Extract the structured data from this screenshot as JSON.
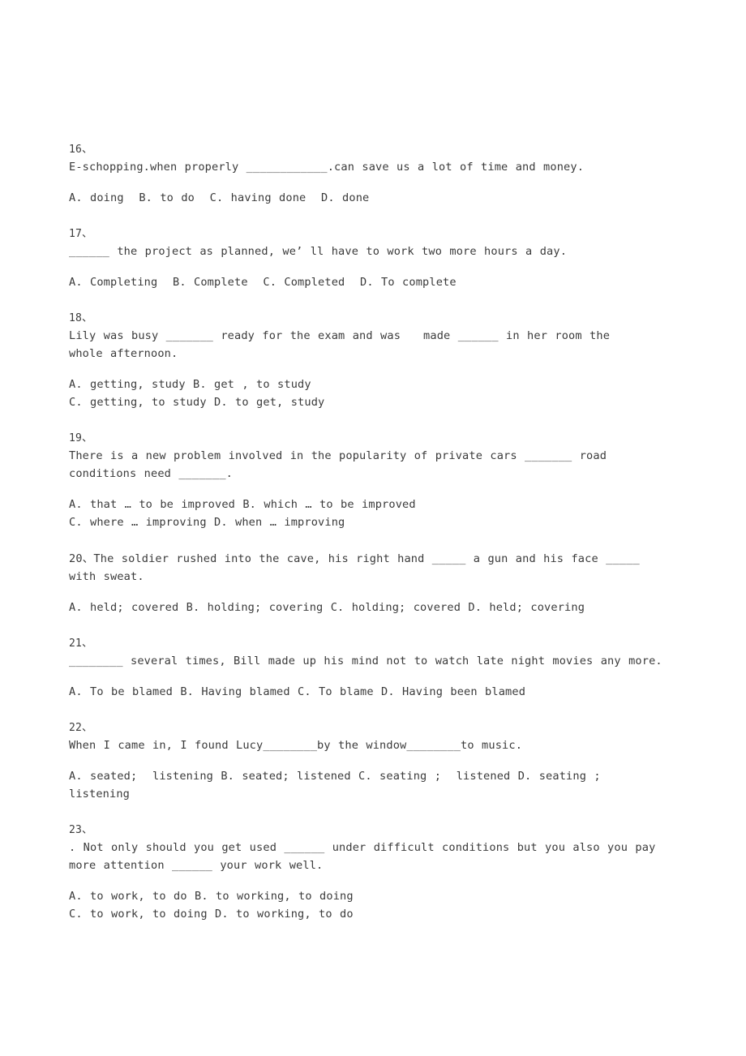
{
  "document": {
    "type": "worksheet",
    "subject": "English grammar multiple choice",
    "page_background": "#ffffff",
    "text_color": "#3a3a3a"
  },
  "questions": [
    {
      "number": "16、",
      "stem": "E-schopping.when properly ____________.can save us a lot of time and money.",
      "options": "A. doing  B. to do  C. having done  D. done"
    },
    {
      "number": "17、",
      "stem": "______ the project as planned, we’ ll have to work two more hours a day.",
      "options": "A. Completing  B. Complete  C. Completed  D. To complete"
    },
    {
      "number": "18、",
      "stem": "Lily was busy _______ ready for the exam and was   made ______ in her room the\nwhole afternoon.",
      "options": "A. getting, study B. get , to study\nC. getting, to study D. to get, study"
    },
    {
      "number": "19、",
      "stem": "There is a new problem involved in the popularity of private cars _______ road\nconditions need _______.",
      "options": "A. that … to be improved B. which … to be improved\nC. where … improving D. when … improving"
    },
    {
      "number": "",
      "stem": "20、The soldier rushed into the cave, his right hand _____ a gun and his face _____\nwith sweat.",
      "options": "A. held; covered B. holding; covering C. holding; covered D. held; covering"
    },
    {
      "number": "21、",
      "stem": "________ several times, Bill made up his mind not to watch late night movies any more.",
      "options": "A. To be blamed B. Having blamed C. To blame D. Having been blamed"
    },
    {
      "number": "22、",
      "stem": "When I came in, I found Lucy________by the window________to music.",
      "options": "A. seated;  listening B. seated; listened C. seating ;  listened D. seating ;\nlistening"
    },
    {
      "number": "23、",
      "stem": ". Not only should you get used ______ under difficult conditions but you also you pay\nmore attention ______ your work well.",
      "options": "A. to work, to do B. to working, to doing\nC. to work, to doing D. to working, to do"
    }
  ]
}
